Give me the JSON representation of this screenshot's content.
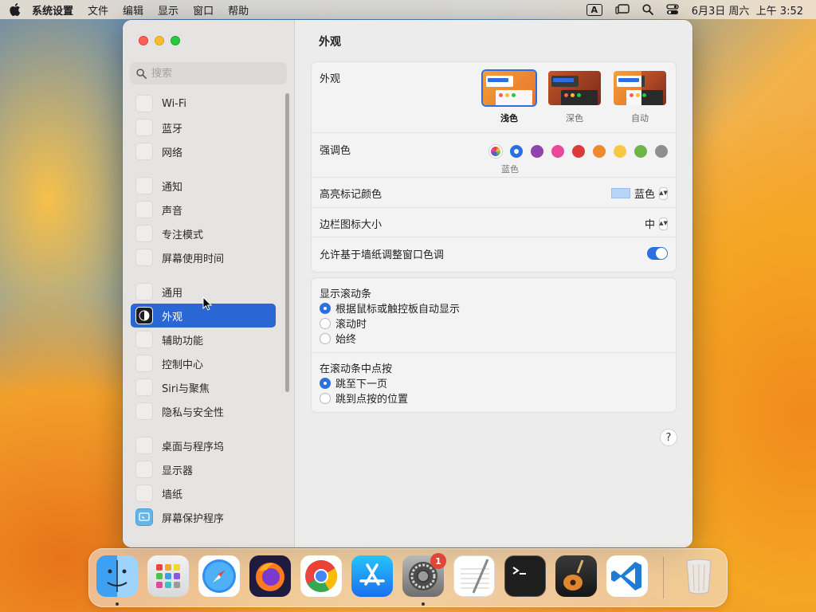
{
  "menubar": {
    "app_name": "系统设置",
    "items": [
      "文件",
      "编辑",
      "显示",
      "窗口",
      "帮助"
    ],
    "input_indicator": "A",
    "datetime": "6月3日 周六  上午 3:52"
  },
  "window": {
    "title": "外观",
    "search_placeholder": "搜索"
  },
  "sidebar": {
    "groups": [
      [
        {
          "label": "Wi-Fi"
        },
        {
          "label": "蓝牙"
        },
        {
          "label": "网络"
        }
      ],
      [
        {
          "label": "通知"
        },
        {
          "label": "声音"
        },
        {
          "label": "专注模式"
        },
        {
          "label": "屏幕使用时间"
        }
      ],
      [
        {
          "label": "通用"
        },
        {
          "label": "外观",
          "active": true
        },
        {
          "label": "辅助功能"
        },
        {
          "label": "控制中心"
        },
        {
          "label": "Siri与聚焦"
        },
        {
          "label": "隐私与安全性"
        }
      ],
      [
        {
          "label": "桌面与程序坞"
        },
        {
          "label": "显示器"
        },
        {
          "label": "墙纸"
        },
        {
          "label": "屏幕保护程序"
        }
      ]
    ]
  },
  "appearance": {
    "label": "外观",
    "options": [
      {
        "caption": "浅色",
        "selected": true
      },
      {
        "caption": "深色",
        "selected": false
      },
      {
        "caption": "自动",
        "selected": false
      }
    ]
  },
  "accent": {
    "label": "强调色",
    "selected_name": "蓝色",
    "colors": [
      "multicolor",
      "#2b6fe0",
      "#8e44ad",
      "#e7489a",
      "#d93a3a",
      "#ee8a2e",
      "#f4c842",
      "#6db54a",
      "#8e8e8e"
    ]
  },
  "highlight": {
    "label": "高亮标记颜色",
    "value": "蓝色"
  },
  "sidebar_icon_size": {
    "label": "边栏图标大小",
    "value": "中"
  },
  "wallpaper_tint": {
    "label": "允许基于墙纸调整窗口色调",
    "on": true
  },
  "scrollbars": {
    "label": "显示滚动条",
    "options": [
      {
        "label": "根据鼠标或触控板自动显示",
        "selected": true
      },
      {
        "label": "滚动时",
        "selected": false
      },
      {
        "label": "始终",
        "selected": false
      }
    ]
  },
  "click_scroll": {
    "label": "在滚动条中点按",
    "options": [
      {
        "label": "跳至下一页",
        "selected": true
      },
      {
        "label": "跳到点按的位置",
        "selected": false
      }
    ]
  },
  "help": "?",
  "dock": {
    "apps": [
      {
        "name": "finder-icon",
        "running": true
      },
      {
        "name": "launchpad-icon"
      },
      {
        "name": "safari-icon"
      },
      {
        "name": "firefox-icon"
      },
      {
        "name": "chrome-icon"
      },
      {
        "name": "app-store-icon"
      },
      {
        "name": "system-settings-icon",
        "running": true,
        "badge": "1"
      },
      {
        "name": "textedit-icon"
      },
      {
        "name": "terminal-icon"
      },
      {
        "name": "garageband-icon"
      },
      {
        "name": "vscode-icon"
      },
      {
        "name": "trash-icon"
      }
    ]
  }
}
